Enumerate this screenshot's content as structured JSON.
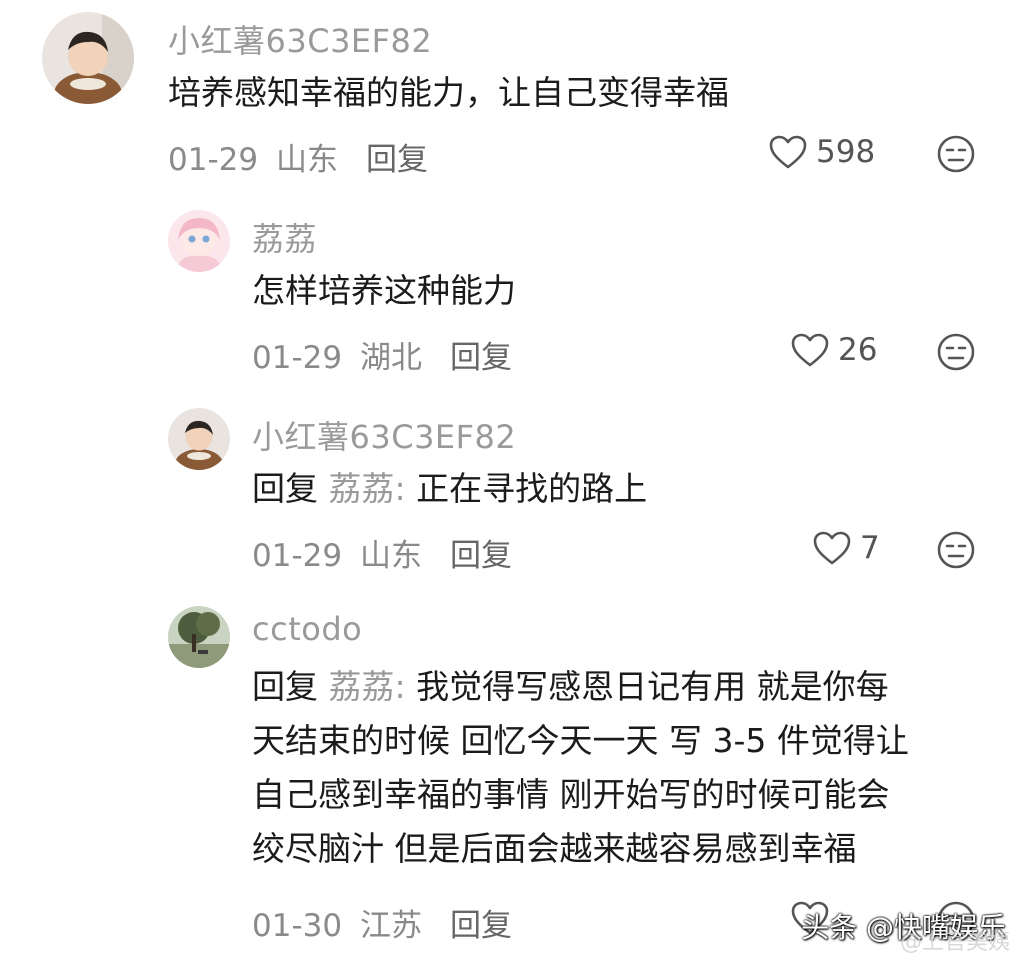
{
  "comments": [
    {
      "username": "小红薯63C3EF82",
      "text": "培养感知幸福的能力，让自己变得幸福",
      "date": "01-29",
      "location": "山东",
      "reply_label": "回复",
      "likes": "598"
    },
    {
      "username": "荔荔",
      "text": "怎样培养这种能力",
      "date": "01-29",
      "location": "湖北",
      "reply_label": "回复",
      "likes": "26"
    },
    {
      "username": "小红薯63C3EF82",
      "reply_prefix": "回复",
      "mention": "荔荔:",
      "text": "正在寻找的路上",
      "date": "01-29",
      "location": "山东",
      "reply_label": "回复",
      "likes": "7"
    },
    {
      "username": "cctodo",
      "reply_prefix": "回复",
      "mention": "荔荔:",
      "lines": [
        "我觉得写感恩日记有用 就是你每",
        "天结束的时候 回忆今天一天 写 3-5 件觉得让",
        "自己感到幸福的事情 刚开始写的时候可能会",
        "绞尽脑汁 但是后面会越来越容易感到幸福"
      ],
      "date": "01-30",
      "location": "江苏",
      "reply_label": "回复"
    }
  ],
  "watermark": {
    "text": "头条 @快嘴娱乐",
    "sub": "@上官美姨"
  },
  "icons": {
    "like": "heart-outline-icon",
    "dislike": "meh-face-icon"
  },
  "colors": {
    "username": "#9a9a9a",
    "meta": "#8a8a8a",
    "text": "#1b1b1b"
  }
}
